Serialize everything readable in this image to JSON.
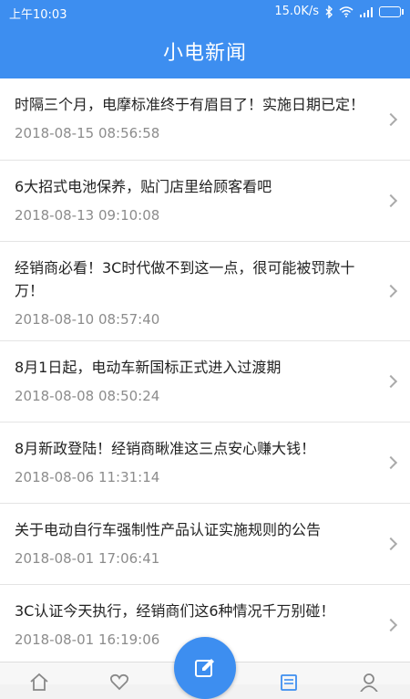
{
  "status_bar": {
    "time": "上午10:03",
    "speed": "15.0K/s"
  },
  "header": {
    "title": "小电新闻"
  },
  "news": [
    {
      "title": "时隔三个月，电摩标准终于有眉目了！实施日期已定！",
      "date": "2018-08-15 08:56:58"
    },
    {
      "title": "6大招式电池保养，贴门店里给顾客看吧",
      "date": "2018-08-13 09:10:08"
    },
    {
      "title": "经销商必看！3C时代做不到这一点，很可能被罚款十万！",
      "date": "2018-08-10 08:57:40"
    },
    {
      "title": "8月1日起，电动车新国标正式进入过渡期",
      "date": "2018-08-08 08:50:24"
    },
    {
      "title": "8月新政登陆！经销商瞅准这三点安心赚大钱！",
      "date": "2018-08-06 11:31:14"
    },
    {
      "title": "关于电动自行车强制性产品认证实施规则的公告",
      "date": "2018-08-01 17:06:41"
    },
    {
      "title": "3C认证今天执行，经销商们这6种情况千万别碰！",
      "date": "2018-08-01 16:19:06"
    }
  ],
  "tab_bar": {
    "icons": [
      "home-icon",
      "heart-icon",
      "edit-icon",
      "news-icon",
      "user-icon"
    ]
  },
  "colors": {
    "primary": "#3d8ef0",
    "text": "#222222",
    "date": "#8c8c8c"
  }
}
